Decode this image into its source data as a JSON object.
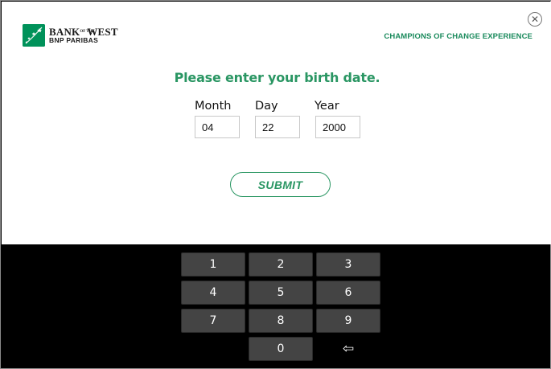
{
  "brand": {
    "name_part1": "BANK",
    "name_ofthe": "OF THE",
    "name_part2": "WEST",
    "subname": "BNP PARIBAS",
    "color": "#00925a"
  },
  "header": {
    "tagline": "CHAMPIONS OF CHANGE EXPERIENCE",
    "close_icon": "close-icon"
  },
  "form": {
    "prompt": "Please enter your birth date.",
    "fields": [
      {
        "label": "Month",
        "value": "04"
      },
      {
        "label": "Day",
        "value": "22"
      },
      {
        "label": "Year",
        "value": "2000"
      }
    ],
    "submit_label": "SUBMIT",
    "accent_color": "#2a9663"
  },
  "keypad": {
    "keys": [
      "1",
      "2",
      "3",
      "4",
      "5",
      "6",
      "7",
      "8",
      "9",
      "0"
    ],
    "backspace_glyph": "⇦",
    "backspace_icon": "backspace-arrow-icon"
  }
}
